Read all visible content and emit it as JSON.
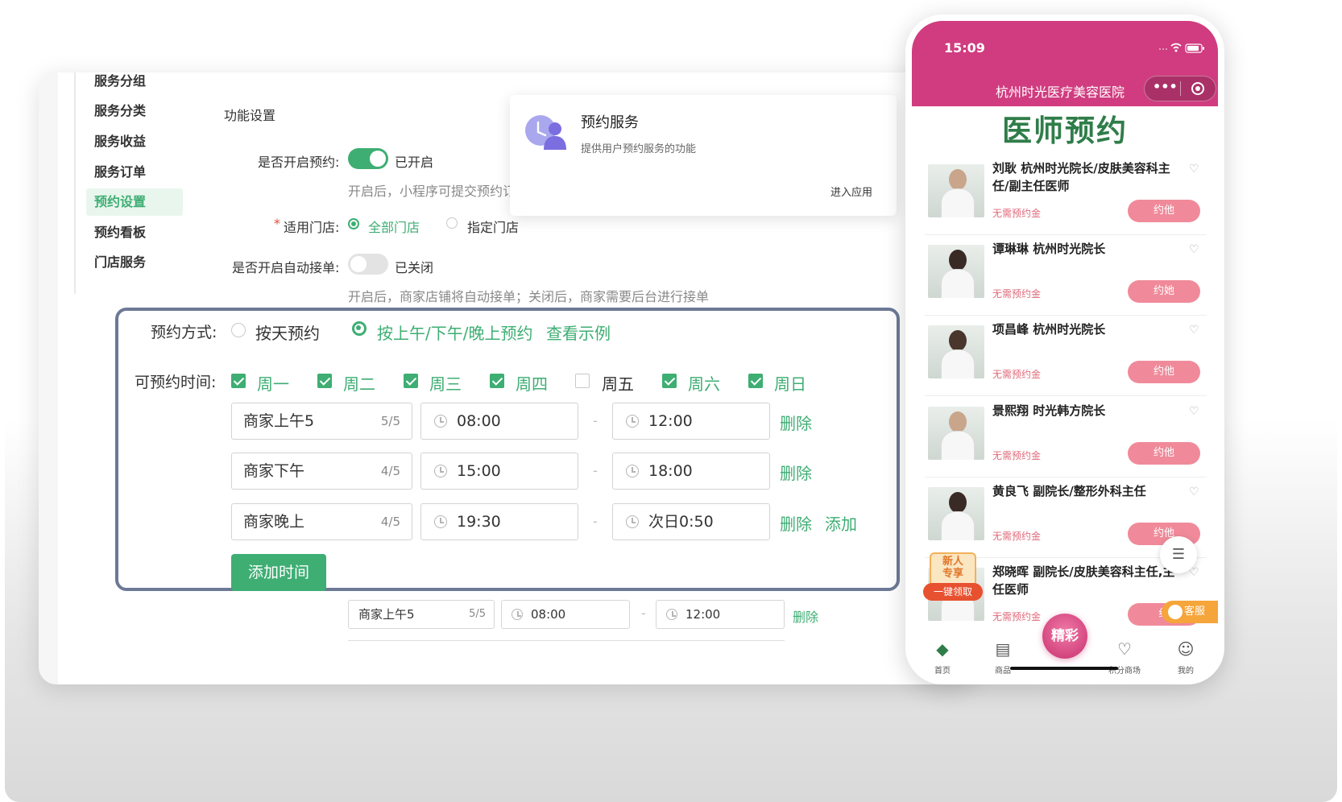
{
  "sidebar": {
    "items": [
      {
        "label": "服务分组"
      },
      {
        "label": "服务分类"
      },
      {
        "label": "服务收益"
      },
      {
        "label": "服务订单"
      },
      {
        "label": "预约设置",
        "active": true
      },
      {
        "label": "预约看板"
      },
      {
        "label": "门店服务"
      }
    ]
  },
  "settings": {
    "section_title": "功能设置",
    "enable_label": "是否开启预约:",
    "enable_state": "已开启",
    "enable_hint": "开启后，小程序可提交预约订",
    "store_required": "*",
    "store_label": "适用门店:",
    "store_options": [
      {
        "label": "全部门店",
        "selected": true
      },
      {
        "label": "指定门店",
        "selected": false
      }
    ],
    "auto_label": "是否开启自动接单:",
    "auto_state": "已关闭",
    "auto_hint": "开启后，商家店铺将自动接单；关闭后，商家需要后台进行接单"
  },
  "app_card": {
    "title": "预约服务",
    "desc": "提供用户预约服务的功能",
    "action": "进入应用"
  },
  "panel": {
    "mode_label": "预约方式:",
    "mode_options": [
      {
        "label": "按天预约",
        "selected": false
      },
      {
        "label": "按上午/下午/晚上预约",
        "selected": true
      }
    ],
    "example_link": "查看示例",
    "days_label": "可预约时间:",
    "days": [
      {
        "label": "周一",
        "checked": true
      },
      {
        "label": "周二",
        "checked": true
      },
      {
        "label": "周三",
        "checked": true
      },
      {
        "label": "周四",
        "checked": true
      },
      {
        "label": "周五",
        "checked": false
      },
      {
        "label": "周六",
        "checked": true
      },
      {
        "label": "周日",
        "checked": true
      }
    ],
    "slots": [
      {
        "name": "商家上午5",
        "count": "5/5",
        "start": "08:00",
        "sep": "-",
        "end": "12:00",
        "delete": "删除"
      },
      {
        "name": "商家下午",
        "count": "4/5",
        "start": "15:00",
        "sep": "-",
        "end": "18:00",
        "delete": "删除"
      },
      {
        "name": "商家晚上",
        "count": "4/5",
        "start": "19:30",
        "sep": "-",
        "end": "次日0:50",
        "delete": "删除",
        "add": "添加"
      }
    ],
    "add_time_button": "添加时间"
  },
  "behind_row": {
    "name": "商家上午5",
    "count": "5/5",
    "start": "08:00",
    "sep": "-",
    "end": "12:00",
    "delete": "删除"
  },
  "phone": {
    "time": "15:09",
    "title": "杭州时光医疗美容医院",
    "banner": "医师预约",
    "doctors": [
      {
        "name": "刘耿 杭州时光院长/皮肤美容科主任/副主任医师",
        "fee": "无需预约金",
        "book": "约他"
      },
      {
        "name": "谭琳琳 杭州时光院长",
        "fee": "无需预约金",
        "book": "约她"
      },
      {
        "name": "项昌峰 杭州时光院长",
        "fee": "无需预约金",
        "book": "约他"
      },
      {
        "name": "景熙翔 时光韩方院长",
        "fee": "无需预约金",
        "book": "约他"
      },
      {
        "name": "黄良飞 副院长/整形外科主任",
        "fee": "无需预约金",
        "book": "约他"
      },
      {
        "name": "郑晓晖 副院长/皮肤美容科主任,主任医师",
        "fee": "无需预约金",
        "book": "约"
      }
    ],
    "promo": {
      "line1": "新人",
      "line2": "专享",
      "line3": "一键领取"
    },
    "kefu": "客服",
    "center_tab": "精彩",
    "tabs": [
      {
        "label": "首页",
        "icon": "home-icon"
      },
      {
        "label": "商品",
        "icon": "list-icon"
      },
      {
        "label": "积分商场",
        "icon": "heart-icon"
      },
      {
        "label": "我的",
        "icon": "user-icon"
      }
    ]
  },
  "colors": {
    "accent": "#3eae73",
    "brand": "#d03c7f",
    "panel_border": "#6c7a96"
  }
}
